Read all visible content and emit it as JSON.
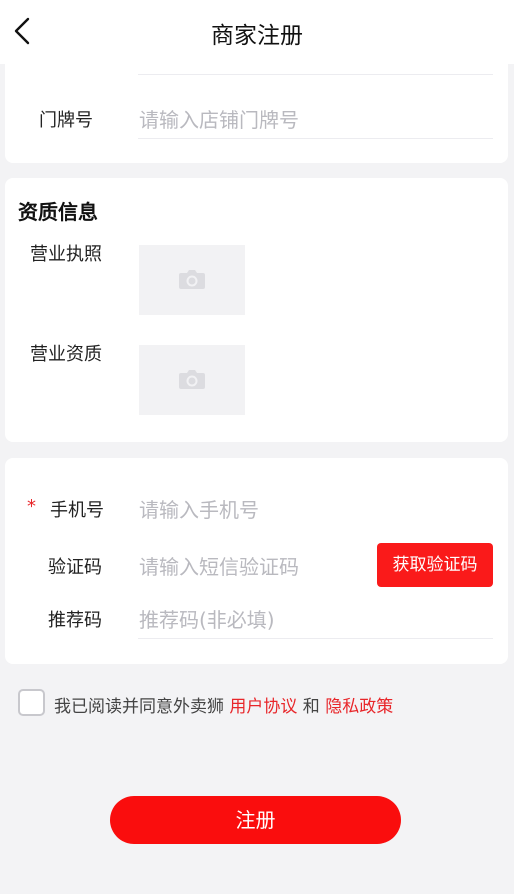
{
  "header": {
    "title": "商家注册",
    "back_icon": "chevron-left-icon"
  },
  "store_card": {
    "door_number_label": "门牌号",
    "door_number_placeholder": "请输入店铺门牌号"
  },
  "qualification": {
    "section_title": "资质信息",
    "business_license_label": "营业执照",
    "business_qualification_label": "营业资质",
    "upload_icon": "camera-icon"
  },
  "account": {
    "required_mark": "*",
    "phone_label": "手机号",
    "phone_placeholder": "请输入手机号",
    "code_label": "验证码",
    "code_placeholder": "请输入短信验证码",
    "get_code_button": "获取验证码",
    "referral_label": "推荐码",
    "referral_placeholder": "推荐码(非必填)"
  },
  "agreement": {
    "text_prefix": "我已阅读并同意外卖狮 ",
    "user_agreement": "用户协议",
    "conjunction": " 和 ",
    "privacy_policy": "隐私政策"
  },
  "submit": {
    "label": "注册"
  },
  "colors": {
    "accent": "#fa1a1a",
    "background": "#f3f3f5",
    "placeholder": "#b9b9bf"
  }
}
